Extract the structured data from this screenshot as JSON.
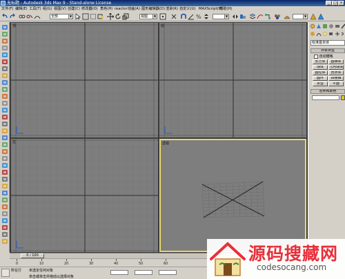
{
  "window": {
    "title": "无标题 - Autodesk 3ds Max 9 - Stand-alone License",
    "min": "_",
    "max": "□",
    "close": "x"
  },
  "menu": [
    "文件(F)",
    "编辑(E)",
    "工具(T)",
    "组(G)",
    "视图(V)",
    "创建(C)",
    "修改器(O)",
    "角色(H)",
    "reactor",
    "动画(A)",
    "图形编辑器(D)",
    "渲染(R)",
    "自定义(U)",
    "MAXScript(M)",
    "帮助(H)"
  ],
  "toolbar": {
    "selection_filter": "全部",
    "ref_coord": "视图",
    "named_selection": ""
  },
  "viewports": {
    "top": "顶",
    "front": "前",
    "left": "左",
    "perspective": "透视"
  },
  "command_panel": {
    "category": "标准基本体",
    "object_type_title": "对象类型",
    "auto_grid": "自动栅格",
    "buttons": [
      "长方体",
      "圆锥体",
      "球体",
      "几何球体",
      "圆柱体",
      "管状体",
      "圆环",
      "四棱锥",
      "茶壶",
      "平面"
    ],
    "name_color_title": "名称和颜色"
  },
  "timeline": {
    "frame": "0 / 100",
    "ticks": [
      "0",
      "10",
      "20",
      "30",
      "40",
      "50",
      "60"
    ]
  },
  "status": {
    "prompt1": "未选定任何对象",
    "prompt2": "单击或单击并拖动以选择对象",
    "prefix": "所在行"
  },
  "watermark": {
    "cn": "源码搜藏网",
    "en": "codesocang.com"
  },
  "colors": {
    "viewport_bg": "#7e7e7e",
    "grid_line": "#6a6a6a",
    "grid_main": "#3a3a3a",
    "active_border": "#e8d96a",
    "ui_face": "#d4d0c8",
    "watermark_red": "#e8303a"
  }
}
